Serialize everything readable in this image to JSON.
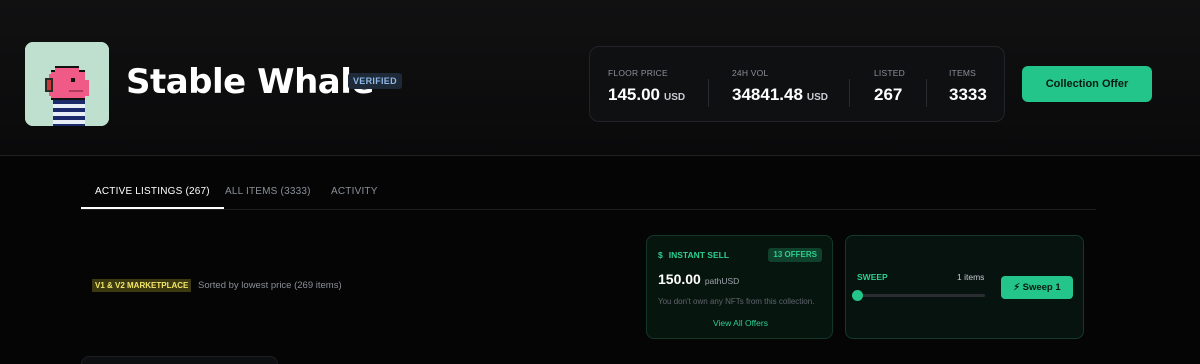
{
  "collection": {
    "name": "Stable Whale",
    "verified_label": "VERIFIED"
  },
  "stats": {
    "floor": {
      "label": "FLOOR PRICE",
      "value": "145.00",
      "unit": "USD"
    },
    "vol": {
      "label": "24H VOL",
      "value": "34841.48",
      "unit": "USD"
    },
    "listed": {
      "label": "LISTED",
      "value": "267"
    },
    "items": {
      "label": "ITEMS",
      "value": "3333"
    }
  },
  "collection_offer_label": "Collection Offer",
  "tabs": [
    {
      "label": "ACTIVE LISTINGS (267)",
      "active": true
    },
    {
      "label": "ALL ITEMS (3333)",
      "active": false
    },
    {
      "label": "ACTIVITY",
      "active": false
    }
  ],
  "marketplace": {
    "tag": "V1 & V2 MARKETPLACE",
    "sort_text": "Sorted by lowest price (269 items)"
  },
  "instant_sell": {
    "icon": "dollar-icon",
    "title": "INSTANT SELL",
    "offers_badge": "13 OFFERS",
    "price": "150.00",
    "unit": "pathUSD",
    "note": "You don't own any NFTs from this collection.",
    "link": "View All Offers"
  },
  "sweep": {
    "label": "SWEEP",
    "count": "1 items",
    "slider_fraction": 0,
    "button_label": "Sweep 1",
    "button_icon": "lightning-icon"
  },
  "colors": {
    "accent": "#23c58a",
    "background": "#050505",
    "verified_bg": "#1e2a38",
    "marketplace_tag_bg": "#3d3a12",
    "marketplace_tag_text": "#f3e86a"
  }
}
